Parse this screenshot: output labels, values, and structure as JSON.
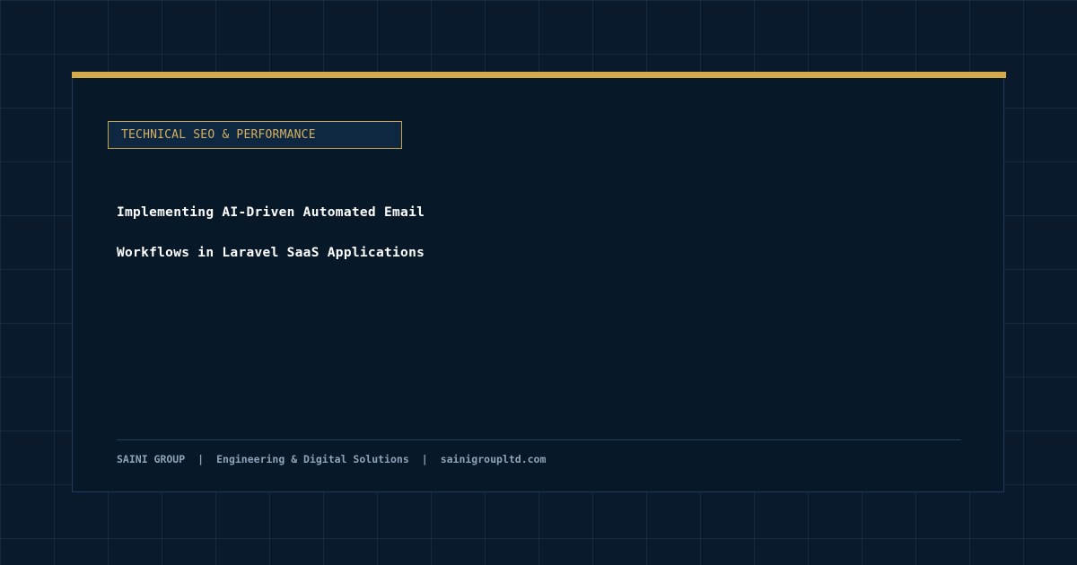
{
  "category": "TECHNICAL SEO & PERFORMANCE",
  "title_lines": [
    "Implementing AI-Driven Automated Email",
    "Workflows in Laravel SaaS Applications"
  ],
  "footer": {
    "brand": "SAINI GROUP",
    "separator": "|",
    "tagline": "Engineering & Digital Solutions",
    "website": "sainigroupltd.com"
  },
  "colors": {
    "background": "#0a1a2c",
    "card": "#071829",
    "accent": "#d4a94a",
    "title": "#ffffff",
    "footer_text": "#8fa3b8"
  }
}
